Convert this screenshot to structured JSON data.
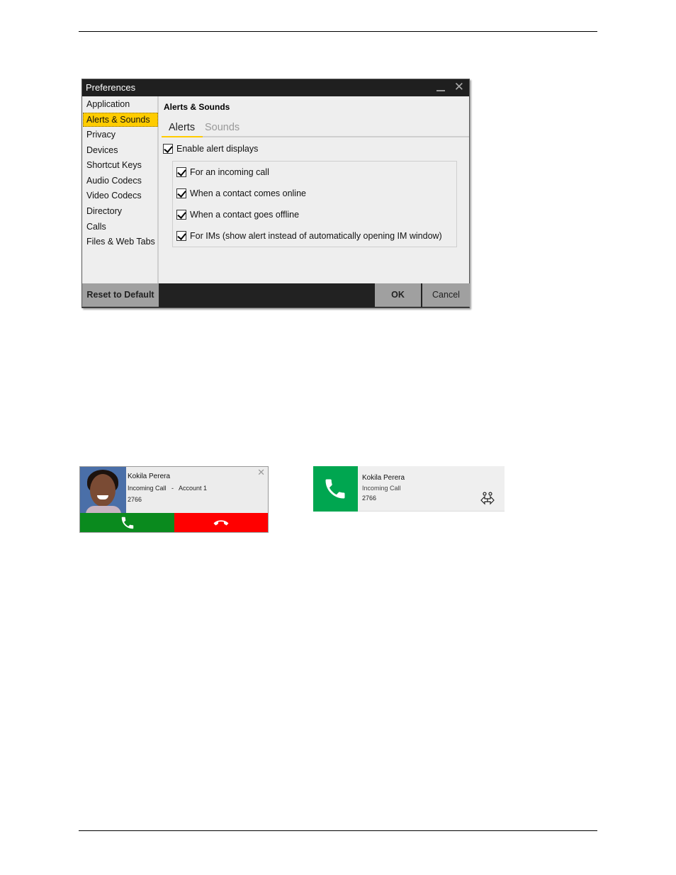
{
  "preferences": {
    "title": "Preferences",
    "sidebar": [
      {
        "label": "Application",
        "active": false
      },
      {
        "label": "Alerts & Sounds",
        "active": true
      },
      {
        "label": "Privacy",
        "active": false
      },
      {
        "label": "Devices",
        "active": false
      },
      {
        "label": "Shortcut Keys",
        "active": false
      },
      {
        "label": "Audio Codecs",
        "active": false
      },
      {
        "label": "Video Codecs",
        "active": false
      },
      {
        "label": "Directory",
        "active": false
      },
      {
        "label": "Calls",
        "active": false
      },
      {
        "label": "Files & Web Tabs",
        "active": false
      }
    ],
    "section_title": "Alerts & Sounds",
    "tabs": [
      {
        "label": "Alerts",
        "active": true
      },
      {
        "label": "Sounds",
        "active": false
      }
    ],
    "enable_alerts": {
      "label": "Enable alert displays",
      "checked": true
    },
    "alert_options": [
      {
        "label": "For an incoming call",
        "checked": true
      },
      {
        "label": "When a contact comes online",
        "checked": true
      },
      {
        "label": "When a contact goes offline",
        "checked": true
      },
      {
        "label": "For IMs (show alert instead of automatically opening IM window)",
        "checked": true
      }
    ],
    "buttons": {
      "reset": "Reset to Default",
      "ok": "OK",
      "cancel": "Cancel"
    },
    "accent_color": "#ffcc00"
  },
  "toast_detailed": {
    "name": "Kokila Perera",
    "status": "Incoming Call   -   Account 1",
    "number": "2766",
    "answer_color": "#0a8a1e",
    "decline_color": "#ff0000"
  },
  "toast_compact": {
    "name": "Kokila Perera",
    "status": "Incoming Call",
    "number": "2766",
    "tile_color": "#00a650"
  }
}
